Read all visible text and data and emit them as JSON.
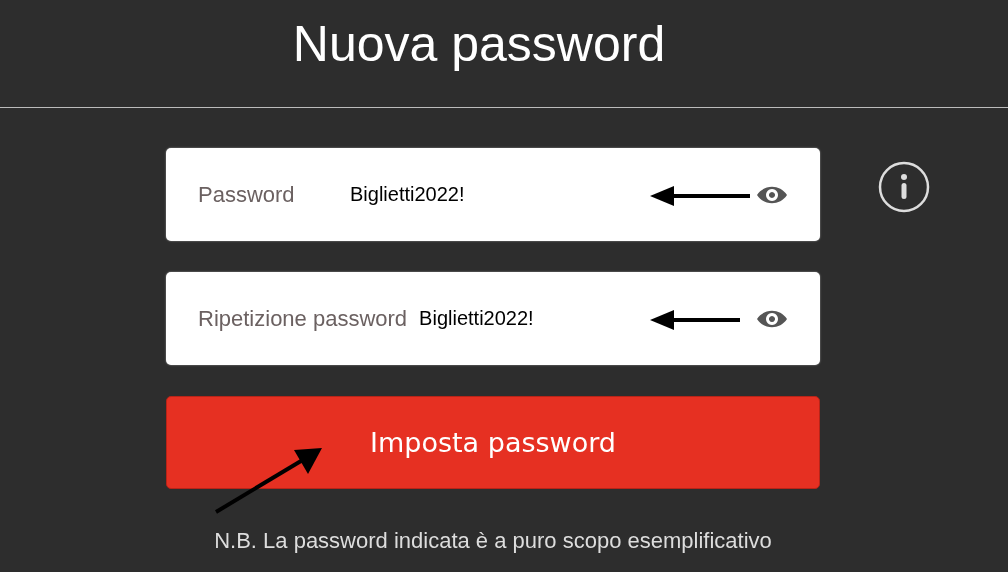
{
  "header": {
    "title": "Nuova password"
  },
  "fields": [
    {
      "label": "Password",
      "value": "Biglietti2022!"
    },
    {
      "label": "Ripetizione password",
      "value": "Biglietti2022!"
    }
  ],
  "submit_button": {
    "label": "Imposta password"
  },
  "note": "N.B. La password indicata è a puro scopo esemplificativo"
}
